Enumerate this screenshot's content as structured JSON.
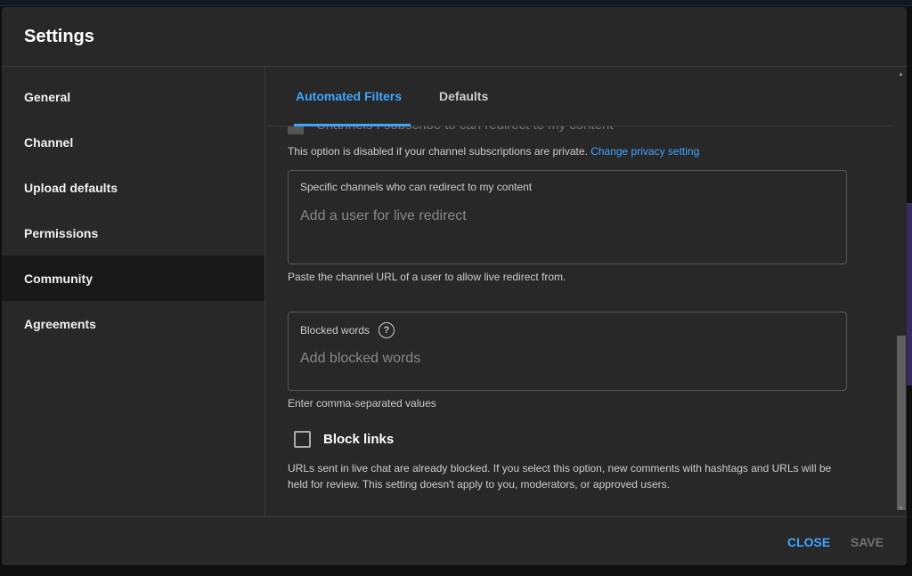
{
  "dialog": {
    "title": "Settings"
  },
  "sidebar": {
    "items": [
      {
        "label": "General"
      },
      {
        "label": "Channel"
      },
      {
        "label": "Upload defaults"
      },
      {
        "label": "Permissions"
      },
      {
        "label": "Community",
        "active": true
      },
      {
        "label": "Agreements"
      }
    ]
  },
  "tabs": [
    {
      "label": "Automated Filters",
      "active": true
    },
    {
      "label": "Defaults"
    }
  ],
  "content": {
    "subscribe_checkbox_label": "Channels I subscribe to can redirect to my content",
    "disabled_note": "This option is disabled if your channel subscriptions are private.",
    "privacy_link": "Change privacy setting",
    "redirect_field": {
      "label": "Specific channels who can redirect to my content",
      "placeholder": "Add a user for live redirect",
      "helper": "Paste the channel URL of a user to allow live redirect from."
    },
    "blocked_words": {
      "label": "Blocked words",
      "help_icon": "?",
      "placeholder": "Add blocked words",
      "helper": "Enter comma-separated values"
    },
    "block_links": {
      "label": "Block links",
      "checked": false,
      "description": "URLs sent in live chat are already blocked. If you select this option, new comments with hashtags and URLs will be held for review. This setting doesn't apply to you, moderators, or approved users."
    }
  },
  "footer": {
    "close": "CLOSE",
    "save": "SAVE"
  },
  "colors": {
    "accent": "#3ea6ff",
    "dialog_bg": "#282828"
  }
}
